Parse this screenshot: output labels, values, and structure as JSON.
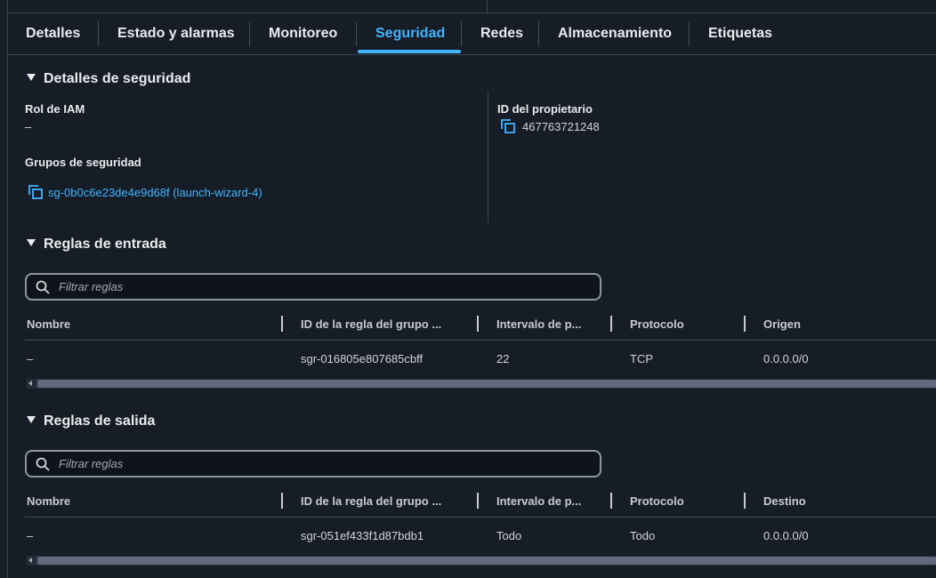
{
  "tabs": [
    {
      "label": "Detalles"
    },
    {
      "label": "Estado y alarmas"
    },
    {
      "label": "Monitoreo"
    },
    {
      "label": "Seguridad"
    },
    {
      "label": "Redes"
    },
    {
      "label": "Almacenamiento"
    },
    {
      "label": "Etiquetas"
    }
  ],
  "active_tab": "Seguridad",
  "security_details": {
    "title": "Detalles de seguridad",
    "iam_role_label": "Rol de IAM",
    "iam_role_value": "–",
    "security_groups_label": "Grupos de seguridad",
    "security_group_link": "sg-0b0c6e23de4e9d68f (launch-wizard-4)",
    "owner_id_label": "ID del propietario",
    "owner_id_value": "467763721248"
  },
  "inbound": {
    "title": "Reglas de entrada",
    "filter_placeholder": "Filtrar reglas",
    "columns": [
      "Nombre",
      "ID de la regla del grupo ...",
      "Intervalo de p...",
      "Protocolo",
      "Origen"
    ],
    "rows": [
      [
        "–",
        "sgr-016805e807685cbff",
        "22",
        "TCP",
        "0.0.0.0/0"
      ]
    ]
  },
  "outbound": {
    "title": "Reglas de salida",
    "filter_placeholder": "Filtrar reglas",
    "columns": [
      "Nombre",
      "ID de la regla del grupo ...",
      "Intervalo de p...",
      "Protocolo",
      "Destino"
    ],
    "rows": [
      [
        "–",
        "sgr-051ef433f1d87bdb1",
        "Todo",
        "Todo",
        "0.0.0.0/0"
      ]
    ]
  },
  "colors": {
    "background": "#161d26",
    "accent": "#42b4ff",
    "text": "#e9ebed"
  }
}
